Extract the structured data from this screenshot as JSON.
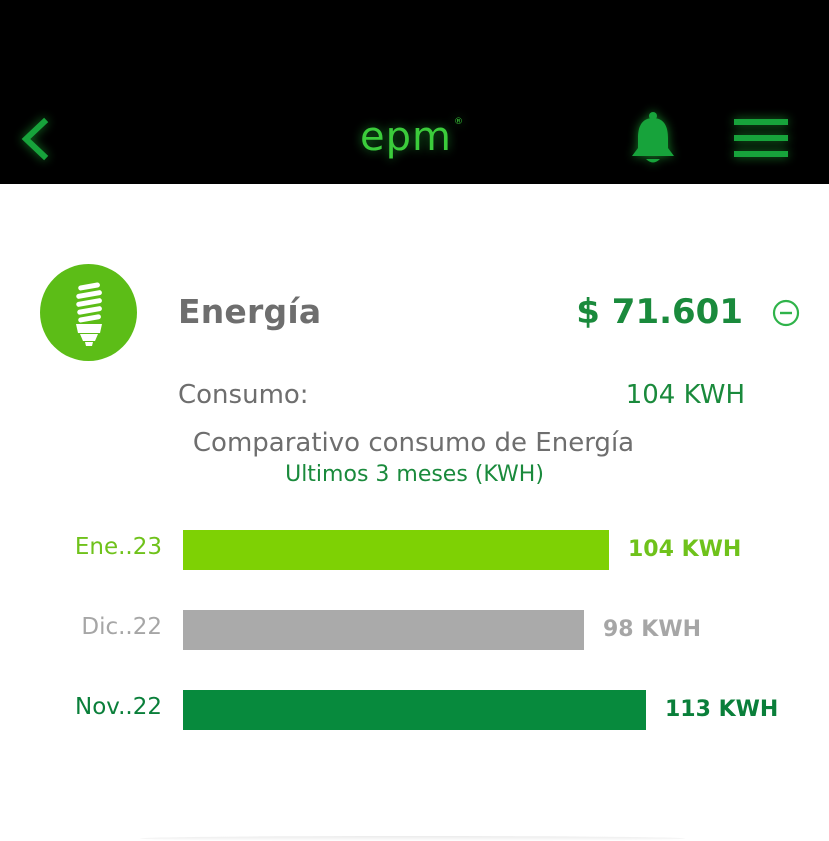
{
  "header": {
    "logo_text": "epm",
    "logo_mark": "®",
    "back_icon": "chevron-left-icon",
    "bell_icon": "bell-icon",
    "menu_icon": "hamburger-menu-icon"
  },
  "service": {
    "icon": "lightbulb-icon",
    "title": "Energía",
    "amount": "$ 71.601",
    "collapse_icon": "minus-circle-icon",
    "consumo_label": "Consumo:",
    "consumo_value": "104 KWH"
  },
  "comparison": {
    "title": "Comparativo consumo de Energía",
    "subtitle": "Ultimos 3 meses (KWH)"
  },
  "chart_data": {
    "type": "bar",
    "orientation": "horizontal",
    "categories": [
      "Ene..23",
      "Dic..22",
      "Nov..22"
    ],
    "values": [
      104,
      98,
      113
    ],
    "value_labels": [
      "104 KWH",
      "98 KWH",
      "113 KWH"
    ],
    "colors": [
      "#7ed104",
      "#aaaaaa",
      "#078a3d"
    ],
    "label_colors": [
      "#6fc21b",
      "#a6a6a6",
      "#0a7f3a"
    ]
  },
  "colors": {
    "header_bg": "#000000",
    "accent_green": "#1a8a3c",
    "icon_green": "#5cbd17",
    "text_gray": "#6e6e6e"
  }
}
